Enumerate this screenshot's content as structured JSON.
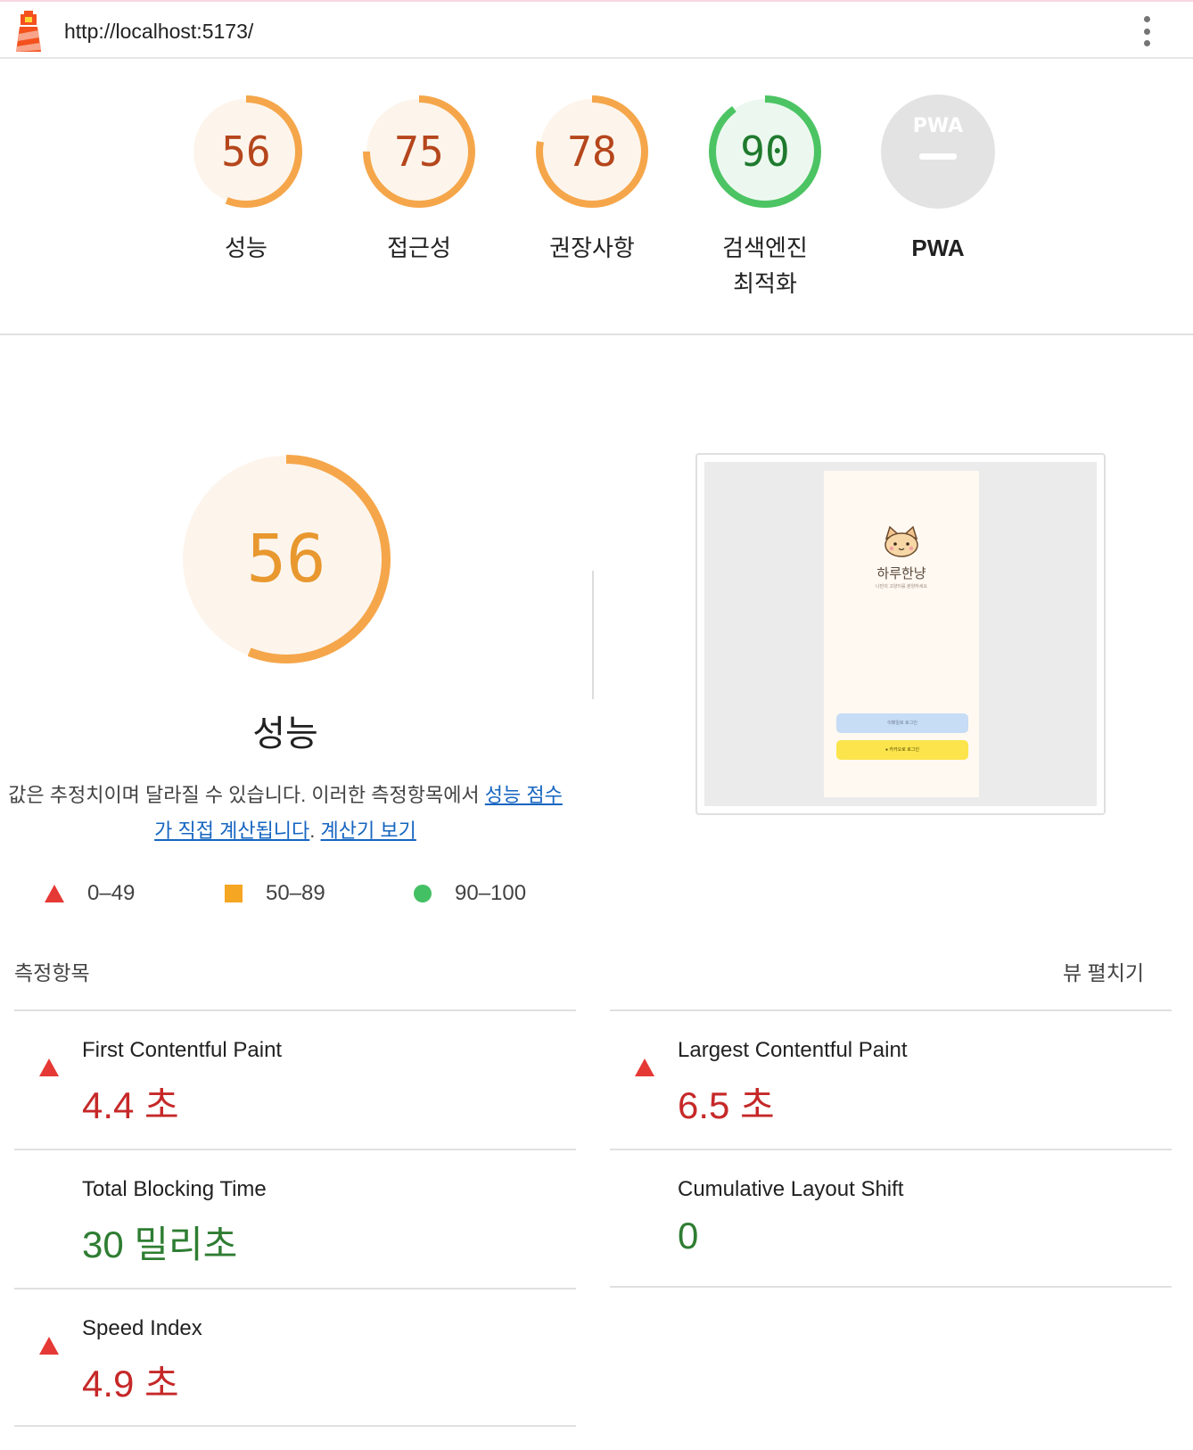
{
  "browser": {
    "url": "http://localhost:5173/",
    "logo_icon": "lighthouse-icon",
    "menu_icon": "more-vert-icon"
  },
  "categories": [
    {
      "score": "56",
      "label": "성능",
      "value": 56,
      "color": "#f5a64a",
      "text_color": "#b5461c",
      "bg": "#fdf5ec"
    },
    {
      "score": "75",
      "label": "접근성",
      "value": 75,
      "color": "#f5a64a",
      "text_color": "#b5461c",
      "bg": "#fdf5ec"
    },
    {
      "score": "78",
      "label": "권장사항",
      "value": 78,
      "color": "#f5a64a",
      "text_color": "#b5461c",
      "bg": "#fdf5ec"
    },
    {
      "score": "90",
      "label": "검색엔진\n최적화",
      "label_line1": "검색엔진",
      "label_line2": "최적화",
      "value": 90,
      "color": "#4cc463",
      "text_color": "#1f7a2e",
      "bg": "#ecf8ef"
    },
    {
      "score": "—",
      "label": "PWA",
      "badge": "PWA",
      "value": 0,
      "color": "#e3e3e3",
      "text_color": "#ffffff",
      "bg": "#e3e3e3"
    }
  ],
  "performance": {
    "score": "56",
    "value": 56,
    "title": "성능",
    "desc_text": "값은 추정치이며 달라질 수 있습니다. 이러한 측정항목에서 ",
    "desc_link1": "성능 점수가 직접 계산됩니다",
    "desc_sep": ". ",
    "desc_link2": "계산기 보기"
  },
  "screenshot": {
    "app_name": "하루한냥",
    "app_subtitle": "나만의 고양이를 분양하세요",
    "email_button": "이메일로 로그인",
    "kakao_button": "● 카카오로 로그인"
  },
  "legend": [
    {
      "shape": "triangle",
      "range": "0–49",
      "color": "#e53935"
    },
    {
      "shape": "square",
      "range": "50–89",
      "color": "#f5a623"
    },
    {
      "shape": "circle",
      "range": "90–100",
      "color": "#43c063"
    }
  ],
  "metrics_header": "측정항목",
  "expand_label": "뷰 펼치기",
  "metrics": [
    {
      "name": "First Contentful Paint",
      "value": "4.4 초",
      "status": "fail"
    },
    {
      "name": "Largest Contentful Paint",
      "value": "6.5 초",
      "status": "fail"
    },
    {
      "name": "Total Blocking Time",
      "value": "30 밀리초",
      "status": "pass"
    },
    {
      "name": "Cumulative Layout Shift",
      "value": "0",
      "status": "pass"
    },
    {
      "name": "Speed Index",
      "value": "4.9 초",
      "status": "fail"
    }
  ]
}
